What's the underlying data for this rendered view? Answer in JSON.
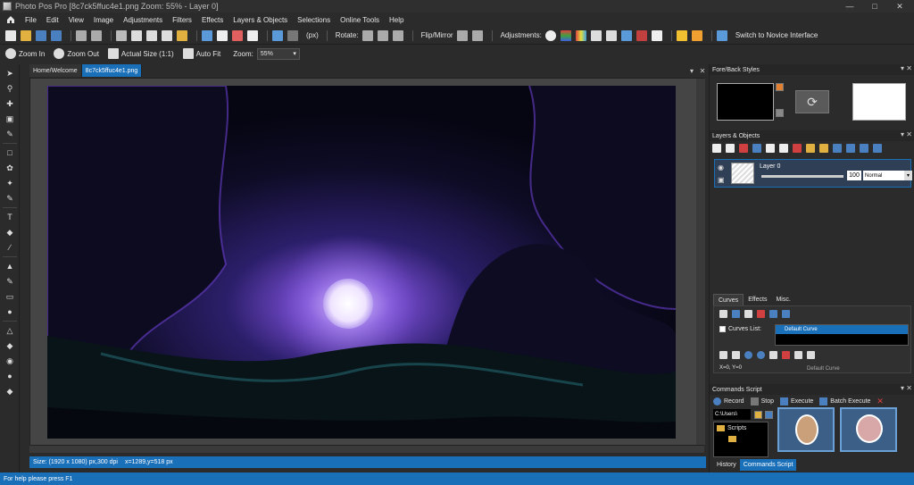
{
  "window": {
    "title": "Photo Pos Pro [8c7ck5ffuc4e1.png Zoom: 55% - Layer 0]"
  },
  "menu": [
    "File",
    "Edit",
    "View",
    "Image",
    "Adjustments",
    "Filters",
    "Effects",
    "Layers & Objects",
    "Selections",
    "Online Tools",
    "Help"
  ],
  "toolbar": {
    "units": "(px)",
    "rotate_label": "Rotate:",
    "flip_label": "Flip/Mirror",
    "adjustments_label": "Adjustments:",
    "novice_label": "Switch to Novice Interface"
  },
  "zoombar": {
    "zoom_in": "Zoom In",
    "zoom_out": "Zoom Out",
    "actual_size": "Actual Size (1:1)",
    "auto_fit": "Auto Fit",
    "zoom_label": "Zoom:",
    "zoom_value": "55%"
  },
  "doc_tabs": [
    "Home/Welcome",
    "8c7ck5ffuc4e1.png"
  ],
  "status": {
    "size": "Size: (1920 x 1080) px,300 dpi",
    "coords": "x=1289,y=518 px",
    "help": "For help please press F1"
  },
  "panels": {
    "fore_back": "Fore/Back Styles",
    "layers": "Layers & Objects",
    "commands": "Commands Script"
  },
  "layer": {
    "name": "Layer 0",
    "opacity": "100",
    "blend": "Normal"
  },
  "subtabs": [
    "Curves",
    "Effects",
    "Misc."
  ],
  "curves": {
    "list_label": "Curves List:",
    "default_item": "Default Curve",
    "xy": "X=0, Y=0",
    "brightness": "Default Curve"
  },
  "commands": {
    "record": "Record",
    "stop": "Stop",
    "execute": "Execute",
    "batch": "Batch Execute",
    "path": "C:\\Users\\",
    "folder": "Scripts"
  },
  "bottom_tabs": [
    "History",
    "Commands Script"
  ],
  "colors": {
    "accent": "#1a6fb9",
    "background": "#2b2b2b",
    "panel": "#303030"
  }
}
